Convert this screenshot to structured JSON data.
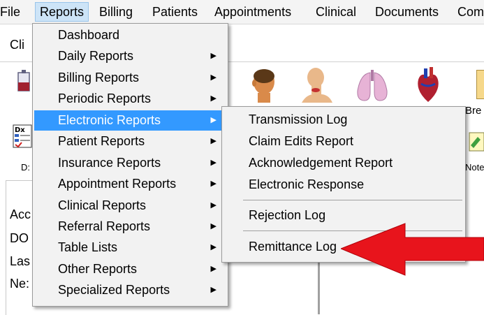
{
  "menubar": {
    "items": [
      "File",
      "Reports",
      "Billing",
      "Patients",
      "Appointments",
      "Clinical",
      "Documents",
      "Com"
    ]
  },
  "background": {
    "tab_label": "Cli",
    "dx_label": "D:",
    "toolbar_labels": [
      "Bre",
      "Note"
    ],
    "patient_labels": [
      "Acc",
      "DO",
      "Las",
      "Ne:"
    ]
  },
  "reports_menu": {
    "items": [
      {
        "label": "Dashboard",
        "submenu": false
      },
      {
        "label": "Daily Reports",
        "submenu": true
      },
      {
        "label": "Billing Reports",
        "submenu": true
      },
      {
        "label": "Periodic Reports",
        "submenu": true
      },
      {
        "label": "Electronic Reports",
        "submenu": true,
        "highlighted": true
      },
      {
        "label": "Patient Reports",
        "submenu": true
      },
      {
        "label": "Insurance Reports",
        "submenu": true
      },
      {
        "label": "Appointment Reports",
        "submenu": true
      },
      {
        "label": "Clinical Reports",
        "submenu": true
      },
      {
        "label": "Referral Reports",
        "submenu": true
      },
      {
        "label": "Table Lists",
        "submenu": true
      },
      {
        "label": "Other Reports",
        "submenu": true
      },
      {
        "label": "Specialized Reports",
        "submenu": true
      }
    ]
  },
  "electronic_submenu": {
    "items": [
      {
        "label": "Transmission Log"
      },
      {
        "label": "Claim Edits Report"
      },
      {
        "label": "Acknowledgement Report"
      },
      {
        "label": "Electronic Response"
      },
      {
        "label": "Rejection Log"
      },
      {
        "label": "Remittance Log"
      }
    ]
  },
  "colors": {
    "highlight": "#3399ff",
    "menubar_active": "#cde4f7",
    "arrow": "#e8141c"
  }
}
